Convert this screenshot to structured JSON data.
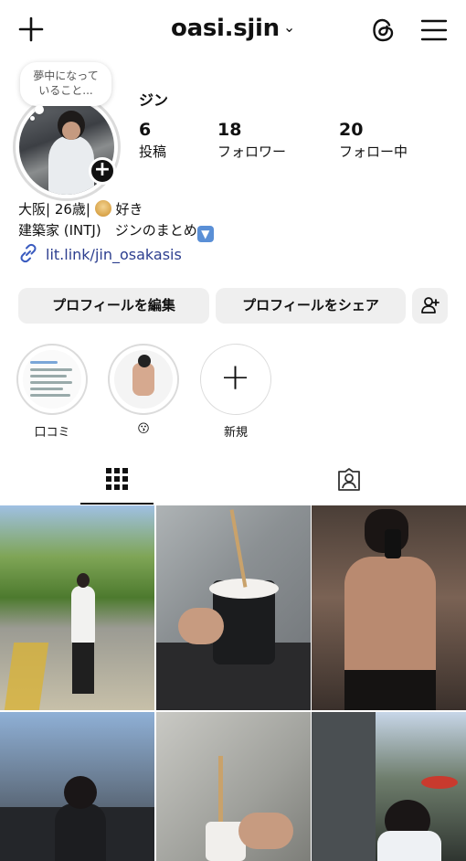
{
  "header": {
    "username": "oasi.sjin",
    "chevron": "⌄",
    "icons": {
      "create": "plus-icon",
      "threads": "threads-icon",
      "menu": "menu-icon"
    }
  },
  "note": {
    "line1": "夢中になって",
    "line2": "いること..."
  },
  "profile": {
    "display_name": "ジン",
    "stats": [
      {
        "value": "6",
        "label": "投稿"
      },
      {
        "value": "18",
        "label": "フォロワー"
      },
      {
        "value": "20",
        "label": "フォロー中"
      }
    ],
    "bio": {
      "line1_prefix": "大阪| 26歳| ",
      "line1_suffix": "好き",
      "line2": "建築家 (INTJ)　ジンのまとめ"
    },
    "link": "lit.link/jin_osakasis"
  },
  "actions": {
    "edit": "プロフィールを編集",
    "share": "プロフィールをシェア"
  },
  "highlights": [
    {
      "caption": "口コミ"
    },
    {
      "caption": "😗"
    },
    {
      "caption": "新規"
    }
  ],
  "tabs": {
    "grid": "grid-icon",
    "tagged": "tagged-icon"
  }
}
